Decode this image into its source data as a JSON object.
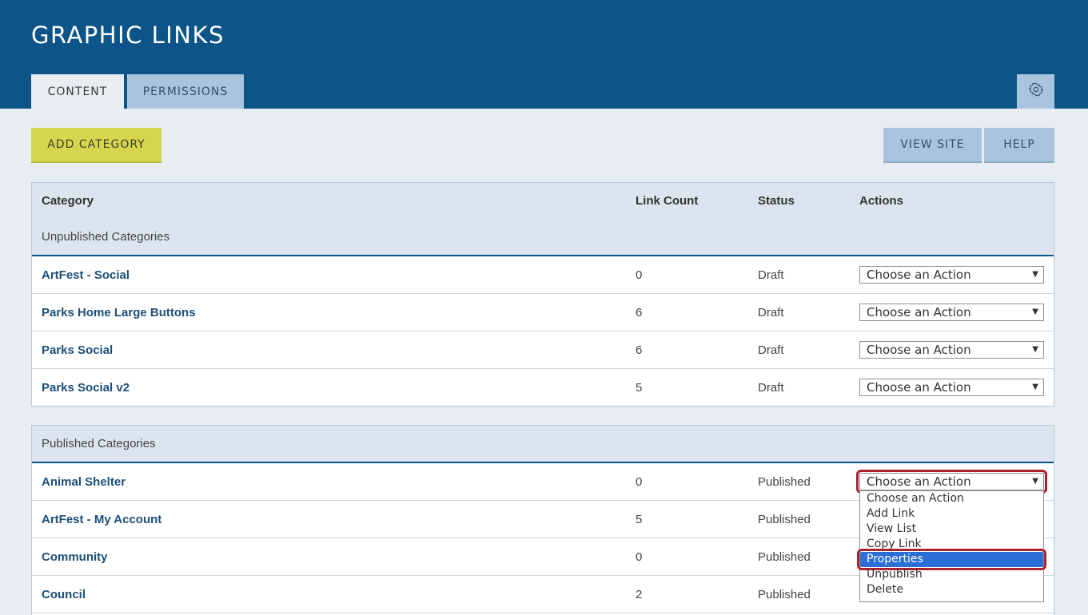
{
  "app": {
    "title": "GRAPHIC LINKS"
  },
  "tabs": [
    {
      "label": "CONTENT",
      "active": true
    },
    {
      "label": "PERMISSIONS",
      "active": false
    }
  ],
  "toolbar": {
    "add_label": "ADD CATEGORY",
    "view_site_label": "VIEW SITE",
    "help_label": "HELP"
  },
  "table": {
    "headers": {
      "category": "Category",
      "link_count": "Link Count",
      "status": "Status",
      "actions": "Actions"
    },
    "unpublished_label": "Unpublished Categories",
    "published_label": "Published Categories",
    "action_placeholder": "Choose an Action",
    "unpublished": [
      {
        "name": "ArtFest - Social",
        "count": "0",
        "status": "Draft"
      },
      {
        "name": "Parks Home Large Buttons",
        "count": "6",
        "status": "Draft"
      },
      {
        "name": "Parks Social",
        "count": "6",
        "status": "Draft"
      },
      {
        "name": "Parks Social v2",
        "count": "5",
        "status": "Draft"
      }
    ],
    "published": [
      {
        "name": "Animal Shelter",
        "count": "0",
        "status": "Published"
      },
      {
        "name": "ArtFest - My Account",
        "count": "5",
        "status": "Published"
      },
      {
        "name": "Community",
        "count": "0",
        "status": "Published"
      },
      {
        "name": "Council",
        "count": "2",
        "status": "Published"
      }
    ]
  },
  "dropdown": {
    "options": [
      "Choose an Action",
      "Add Link",
      "View List",
      "Copy Link",
      "Properties",
      "Unpublish",
      "Delete"
    ],
    "selected": "Properties"
  },
  "colors": {
    "header_bg": "#0d5588",
    "accent_button": "#d6d64e",
    "secondary_button": "#a9c4df",
    "highlight": "#a8232f",
    "selection": "#2b6fd6"
  },
  "icons": {
    "settings": "gear-icon",
    "select_arrow": "dropdown-arrow-icon"
  }
}
